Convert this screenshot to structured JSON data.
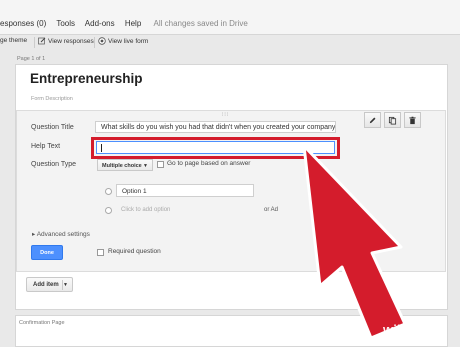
{
  "menubar": {
    "items": [
      "esponses (0)",
      "Tools",
      "Add-ons",
      "Help"
    ],
    "saved_status": "All changes saved in Drive"
  },
  "toolbar": {
    "theme_label": "ge theme",
    "view_responses_label": "View responses",
    "view_live_form_label": "View live form"
  },
  "page_label": "Page 1 of 1",
  "form": {
    "title": "Entrepreneurship",
    "description_placeholder": "Form Description"
  },
  "question": {
    "title_label": "Question Title",
    "title_value": "What skills do you wish you had that didn't when you created your company?",
    "help_label": "Help Text",
    "help_value": "",
    "type_label": "Question Type",
    "type_value": "Multiple choice",
    "go_to_page_label": "Go to page based on answer",
    "option1_value": "Option 1",
    "add_option_placeholder": "Click to add option",
    "or_add_label": "or Ad",
    "advanced_label": "Advanced settings",
    "done_label": "Done",
    "required_label": "Required question",
    "tools": [
      "pencil-icon",
      "duplicate-icon",
      "trash-icon"
    ]
  },
  "add_item_label": "Add item",
  "confirmation_label": "Confirmation Page",
  "annotation": {
    "arrow_color": "#d41c2c"
  },
  "watermark": {
    "part1": "wiki",
    "part2": "How"
  }
}
